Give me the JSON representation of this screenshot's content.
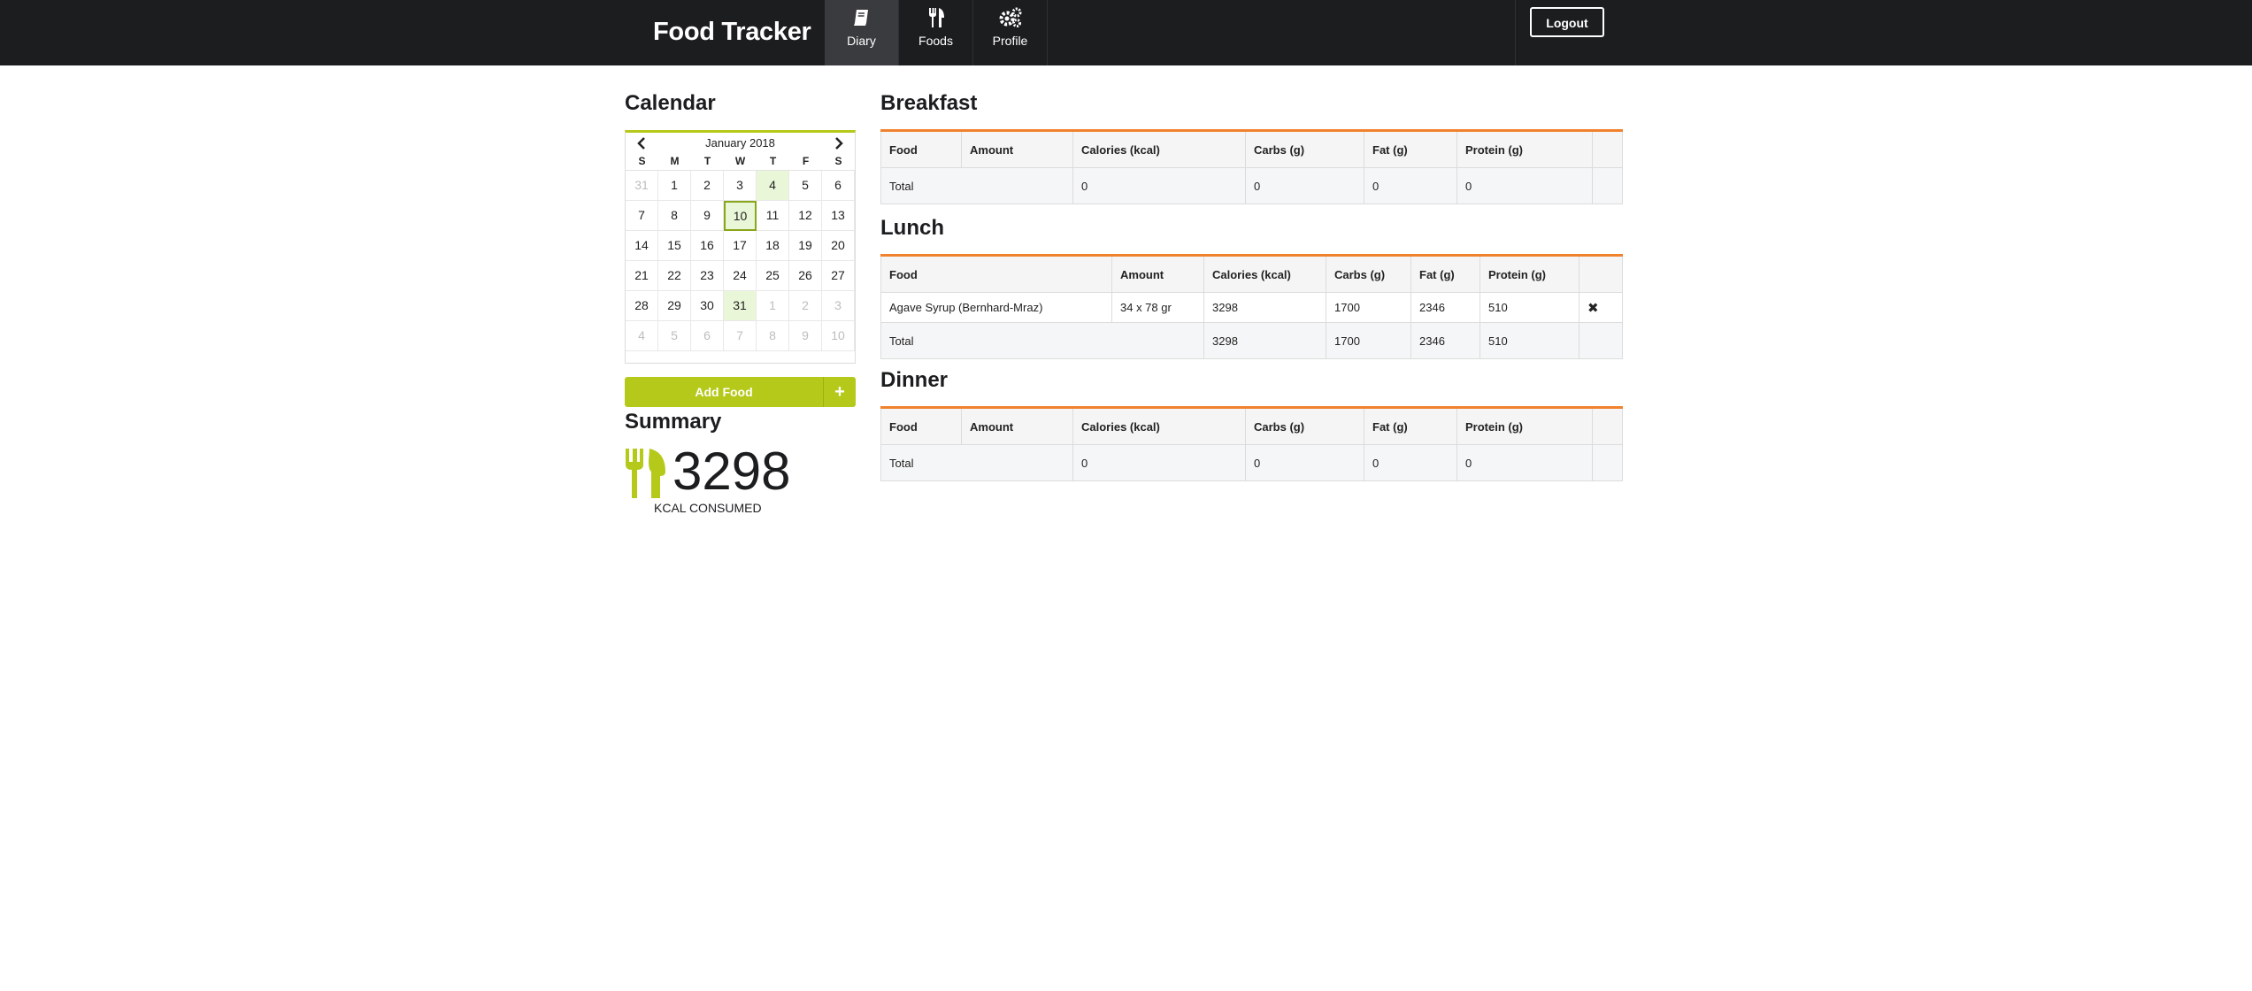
{
  "app": {
    "title": "Food Tracker"
  },
  "nav": {
    "items": [
      {
        "label": "Diary",
        "icon": "book-icon",
        "active": true
      },
      {
        "label": "Foods",
        "icon": "cutlery-icon",
        "active": false
      },
      {
        "label": "Profile",
        "icon": "gears-icon",
        "active": false
      }
    ],
    "logout_label": "Logout"
  },
  "calendar": {
    "heading": "Calendar",
    "month_label": "January 2018",
    "weekdays": [
      "S",
      "M",
      "T",
      "W",
      "T",
      "F",
      "S"
    ],
    "days": [
      {
        "d": "31",
        "muted": true
      },
      {
        "d": "1"
      },
      {
        "d": "2"
      },
      {
        "d": "3"
      },
      {
        "d": "4",
        "entry": true
      },
      {
        "d": "5"
      },
      {
        "d": "6"
      },
      {
        "d": "7"
      },
      {
        "d": "8"
      },
      {
        "d": "9"
      },
      {
        "d": "10",
        "selected": true
      },
      {
        "d": "11"
      },
      {
        "d": "12"
      },
      {
        "d": "13"
      },
      {
        "d": "14"
      },
      {
        "d": "15"
      },
      {
        "d": "16"
      },
      {
        "d": "17"
      },
      {
        "d": "18"
      },
      {
        "d": "19"
      },
      {
        "d": "20"
      },
      {
        "d": "21"
      },
      {
        "d": "22"
      },
      {
        "d": "23"
      },
      {
        "d": "24"
      },
      {
        "d": "25"
      },
      {
        "d": "26"
      },
      {
        "d": "27"
      },
      {
        "d": "28"
      },
      {
        "d": "29"
      },
      {
        "d": "30"
      },
      {
        "d": "31",
        "entry": true
      },
      {
        "d": "1",
        "muted": true
      },
      {
        "d": "2",
        "muted": true
      },
      {
        "d": "3",
        "muted": true
      },
      {
        "d": "4",
        "muted": true
      },
      {
        "d": "5",
        "muted": true
      },
      {
        "d": "6",
        "muted": true
      },
      {
        "d": "7",
        "muted": true
      },
      {
        "d": "8",
        "muted": true
      },
      {
        "d": "9",
        "muted": true
      },
      {
        "d": "10",
        "muted": true
      }
    ]
  },
  "add_food": {
    "label": "Add Food",
    "plus": "+"
  },
  "summary": {
    "heading": "Summary",
    "value": "3298",
    "label": "KCAL CONSUMED"
  },
  "meals": {
    "breakfast": {
      "heading": "Breakfast",
      "columns": [
        "Food",
        "Amount",
        "Calories (kcal)",
        "Carbs (g)",
        "Fat (g)",
        "Protein (g)",
        ""
      ],
      "entries": [],
      "total": {
        "label": "Total",
        "calories": "0",
        "carbs": "0",
        "fat": "0",
        "protein": "0"
      }
    },
    "lunch": {
      "heading": "Lunch",
      "columns": [
        "Food",
        "Amount",
        "Calories (kcal)",
        "Carbs (g)",
        "Fat (g)",
        "Protein (g)",
        ""
      ],
      "entries": [
        {
          "food": "Agave Syrup (Bernhard-Mraz)",
          "amount": "34 x 78 gr",
          "calories": "3298",
          "carbs": "1700",
          "fat": "2346",
          "protein": "510",
          "delete": "✖"
        }
      ],
      "total": {
        "label": "Total",
        "calories": "3298",
        "carbs": "1700",
        "fat": "2346",
        "protein": "510"
      }
    },
    "dinner": {
      "heading": "Dinner",
      "columns": [
        "Food",
        "Amount",
        "Calories (kcal)",
        "Carbs (g)",
        "Fat (g)",
        "Protein (g)",
        ""
      ],
      "entries": [],
      "total": {
        "label": "Total",
        "calories": "0",
        "carbs": "0",
        "fat": "0",
        "protein": "0"
      }
    }
  },
  "colors": {
    "accent_green": "#b5c91b",
    "accent_orange": "#f0822d",
    "nav_bg": "#1c1d1f"
  }
}
